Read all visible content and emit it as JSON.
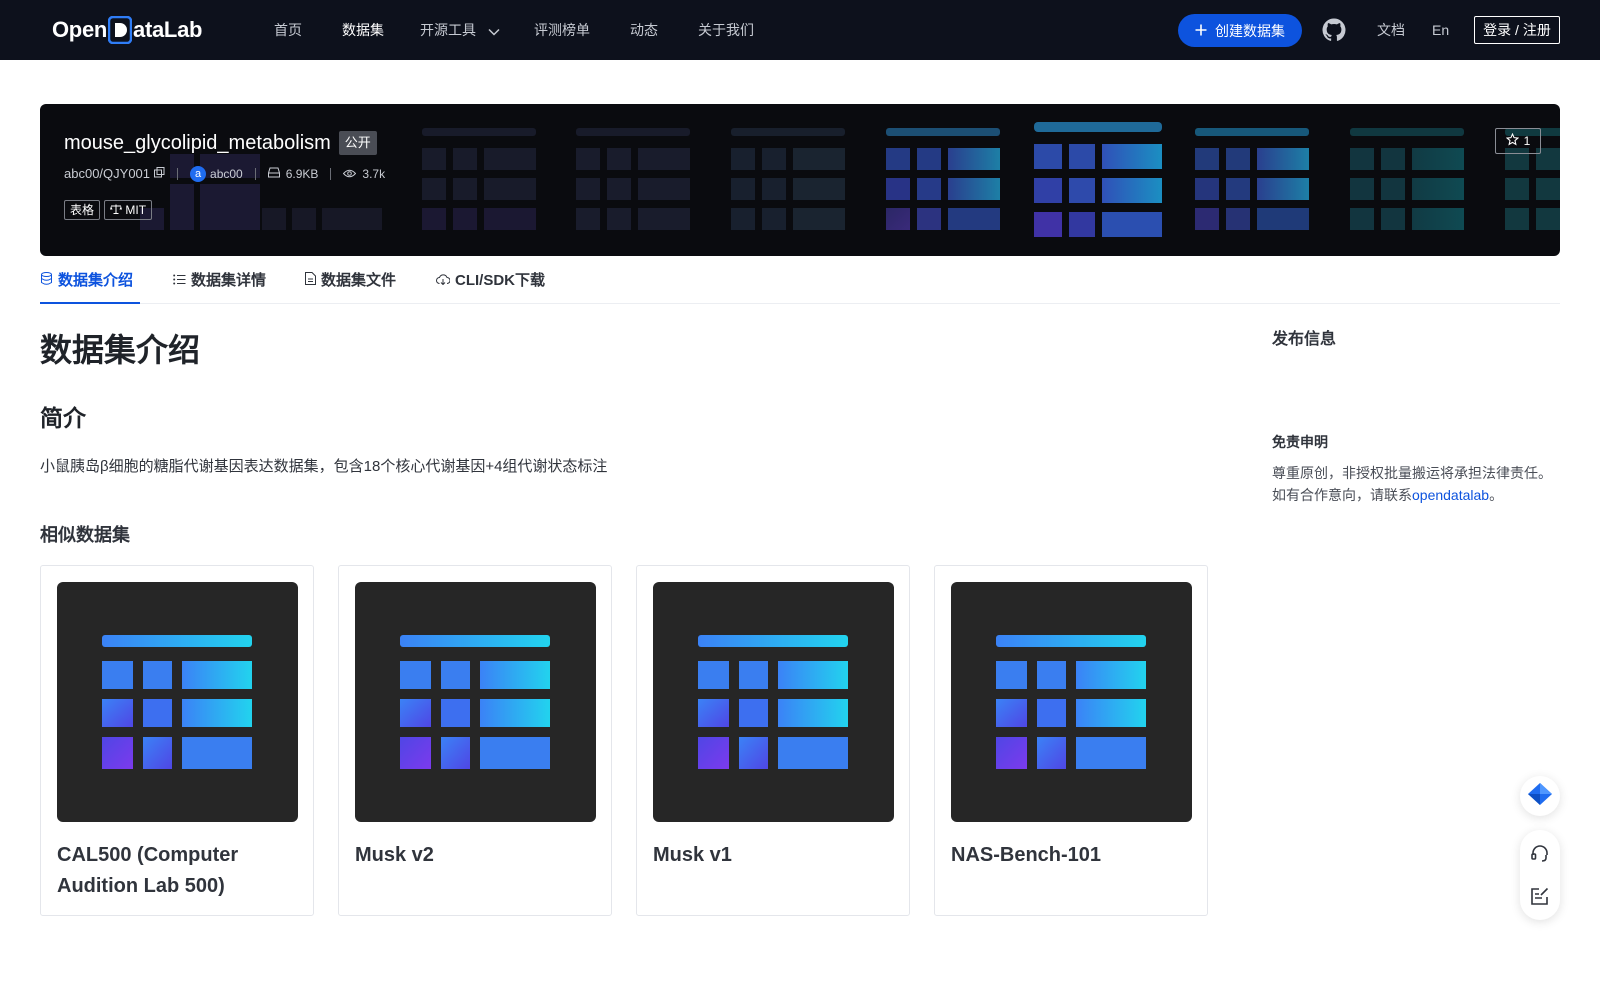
{
  "nav": {
    "logo": {
      "part1": "Open",
      "part2": "ataLab"
    },
    "items": [
      {
        "label": "首页"
      },
      {
        "label": "数据集"
      },
      {
        "label": "开源工具"
      },
      {
        "label": "评测榜单"
      },
      {
        "label": "动态"
      },
      {
        "label": "关于我们"
      }
    ],
    "create_label": "创建数据集",
    "docs_label": "文档",
    "lang_label": "En",
    "login_label": "登录 / 注册"
  },
  "hero": {
    "title": "mouse_glycolipid_metabolism",
    "visibility": "公开",
    "repo": "abc00/QJY001",
    "avatar_letter": "a",
    "owner": "abc00",
    "size": "6.9KB",
    "views": "3.7k",
    "tags": [
      "表格",
      "MIT"
    ],
    "stars": "1"
  },
  "tabs": [
    {
      "label": "数据集介绍"
    },
    {
      "label": "数据集详情"
    },
    {
      "label": "数据集文件"
    },
    {
      "label": "CLI/SDK下载"
    }
  ],
  "main": {
    "title": "数据集介绍",
    "intro_heading": "简介",
    "intro_text": "小鼠胰岛β细胞的糖脂代谢基因表达数据集，包含18个核心代谢基因+4组代谢状态标注",
    "similar_heading": "相似数据集",
    "similar": [
      {
        "title": "CAL500 (Computer Audition Lab 500)"
      },
      {
        "title": "Musk v2"
      },
      {
        "title": "Musk v1"
      },
      {
        "title": "NAS-Bench-101"
      }
    ]
  },
  "sidebar": {
    "publish_heading": "发布信息",
    "disclaimer_heading": "免责申明",
    "disclaimer_line1": "尊重原创，非授权批量搬运将承担法律责任。",
    "disclaimer_line2_prefix": "如有合作意向，请联系",
    "disclaimer_link": "opendatalab",
    "disclaimer_line2_suffix": "。"
  },
  "colors": {
    "nav_bg": "#0d111c",
    "accent": "#0d53de",
    "card_thumb_bg": "#262626"
  },
  "icons": [
    "chevron-down-icon",
    "plus-icon",
    "github-icon",
    "copy-icon",
    "disk-icon",
    "eye-icon",
    "scale-icon",
    "star-icon",
    "database-icon",
    "list-icon",
    "file-icon",
    "cloud-icon",
    "table-icon",
    "feather-icon",
    "headset-icon",
    "edit-note-icon"
  ]
}
